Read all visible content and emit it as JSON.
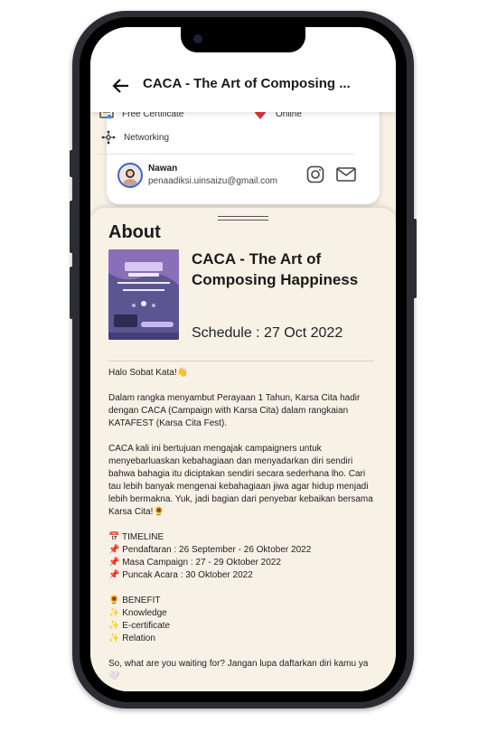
{
  "header": {
    "title": "CACA - The Art of Composing ..."
  },
  "info": {
    "certificate": "Free Certificate",
    "mode": "Online",
    "networking": "Networking"
  },
  "organizer": {
    "name": "Nawan",
    "email": "penaadiksi.uinsaizu@gmail.com"
  },
  "about": {
    "heading": "About",
    "event_title": "CACA - The Art of Composing Happiness",
    "schedule": "Schedule : 27 Oct 2022",
    "description": "Halo Sobat Kata!👋\n\nDalam rangka menyambut Perayaan 1 Tahun, Karsa Cita hadir dengan CACA (Campaign with Karsa Cita) dalam rangkaian KATAFEST (Karsa Cita Fest).\n\nCACA kali ini bertujuan mengajak campaigners untuk menyebarluaskan kebahagiaan dan menyadarkan diri sendiri bahwa bahagia itu diciptakan sendiri secara sederhana lho. Cari tau lebih banyak mengenai kebahagiaan jiwa agar hidup menjadi lebih bermakna. Yuk, jadi bagian dari penyebar kebaikan bersama Karsa Cita!🌻\n\n📅 TIMELINE\n📌 Pendaftaran : 26 September - 26 Oktober 2022\n📌 Masa Campaign : 27 - 29 Oktober 2022\n📌 Puncak Acara : 30 Oktober 2022\n\n🌻 BENEFIT\n✨ Knowledge\n✨ E-certificate\n✨ Relation\n\nSo, what are you waiting for? Jangan lupa daftarkan diri kamu ya🤍"
  },
  "colors": {
    "sheet_bg": "#f8f1e6",
    "header_bg": "#ffffff",
    "poster_bg": "#5b5591",
    "online_heart": "#d9363e"
  },
  "icons": {
    "back": "arrow-left-icon",
    "certificate": "certificate-icon",
    "online": "heart-pin-icon",
    "networking": "network-icon",
    "instagram": "instagram-icon",
    "mail": "mail-icon"
  }
}
